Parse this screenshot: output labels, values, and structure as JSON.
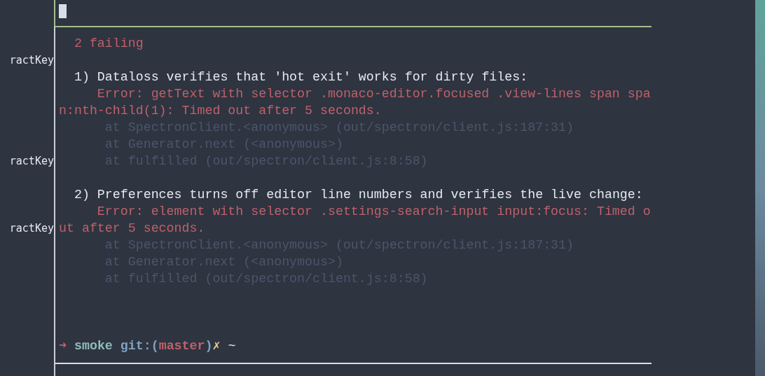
{
  "left_pane": {
    "lines": [
      "ractKey",
      "ractKey",
      "ractKey"
    ]
  },
  "terminal": {
    "summary": "2 failing",
    "failures": [
      {
        "title": "1) Dataloss verifies that 'hot exit' works for dirty files:",
        "error": [
          "Error: getText with selector .monaco-editor.focused .view-lines span spa",
          "n:nth-child(1): Timed out after 5 seconds."
        ],
        "stack": [
          "at SpectronClient.<anonymous> (out/spectron/client.js:187:31)",
          "at Generator.next (<anonymous>)",
          "at fulfilled (out/spectron/client.js:8:58)"
        ]
      },
      {
        "title": "2) Preferences turns off editor line numbers and verifies the live change:",
        "error": [
          "Error: element with selector .settings-search-input input:focus: Timed o",
          "ut after 5 seconds."
        ],
        "stack": [
          "at SpectronClient.<anonymous> (out/spectron/client.js:187:31)",
          "at Generator.next (<anonymous>)",
          "at fulfilled (out/spectron/client.js:8:58)"
        ]
      }
    ],
    "prompt": [
      {
        "kind": "arrow",
        "text": "➜"
      },
      {
        "kind": "dir",
        "text": "smoke"
      },
      {
        "kind": "git",
        "text": "git:("
      },
      {
        "kind": "branch",
        "text": "master"
      },
      {
        "kind": "git",
        "text": ")"
      },
      {
        "kind": "dirty",
        "text": "✗"
      },
      {
        "kind": "plain",
        "text": "~"
      }
    ]
  }
}
